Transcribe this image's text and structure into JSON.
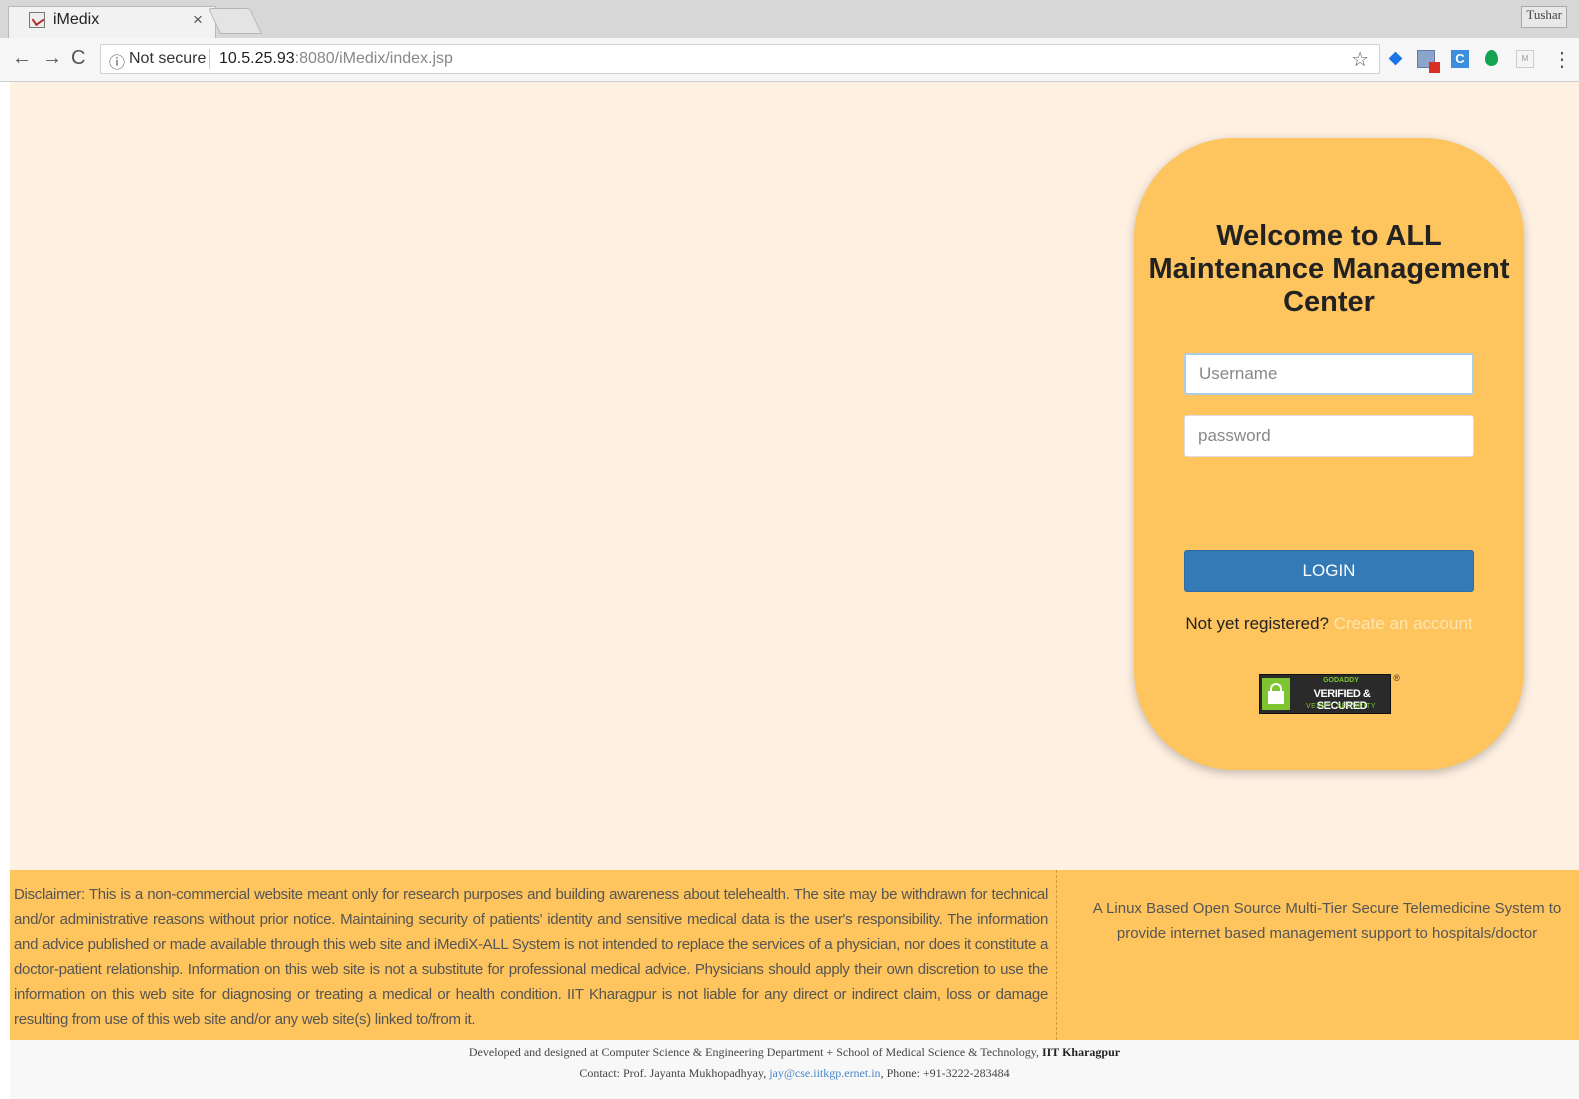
{
  "browser": {
    "tab_title": "iMedix",
    "tab_close": "×",
    "profile": "Tushar",
    "security_label": "Not secure",
    "url_host": "10.5.25.93",
    "url_rest": ":8080/iMedix/index.jsp"
  },
  "login": {
    "title": "Welcome to ALL Maintenance Management Center",
    "username_placeholder": "Username",
    "password_placeholder": "password",
    "login_button": "LOGIN",
    "register_prompt": "Not yet registered?",
    "register_link": "Create an account"
  },
  "seal": {
    "brand": "GODADDY",
    "main": "VERIFIED & SECURED",
    "sub": "VERIFY SECURITY",
    "reg": "®"
  },
  "footer": {
    "disclaimer": "Disclaimer: This is a non-commercial website meant only for research purposes and building awareness about telehealth. The site may be withdrawn for technical and/or administrative reasons without prior notice. Maintaining security of patients' identity and sensitive medical data is the user's responsibility. The information and advice published or made available through this web site and iMediX-ALL System is not intended to replace the services of a physician, nor does it constitute a doctor-patient relationship. Information on this web site is not a substitute for professional medical advice. Physicians should apply their own discretion to use the information on this web site for diagnosing or treating a medical or health condition. IIT Kharagpur is not liable for any direct or indirect claim, loss or damage resulting from use of this web site and/or any web site(s) linked to/from it.",
    "tagline": "A Linux Based Open Source Multi-Tier Secure Telemedicine System to provide internet based management support to hospitals/doctor",
    "credits_prefix": "Developed and designed at Computer Science & Engineering Department + School of Medical Science & Technology,",
    "credits_org": "IIT Kharagpur",
    "contact_prefix": "Contact: Prof. Jayanta Mukhopadhyay,",
    "contact_email": "jay@cse.iitkgp.ernet.in",
    "contact_phone": ", Phone: +91-3222-283484"
  },
  "colors": {
    "page_bg": "#fff1e2",
    "card_bg": "#fec45e",
    "button": "#337ab7"
  }
}
